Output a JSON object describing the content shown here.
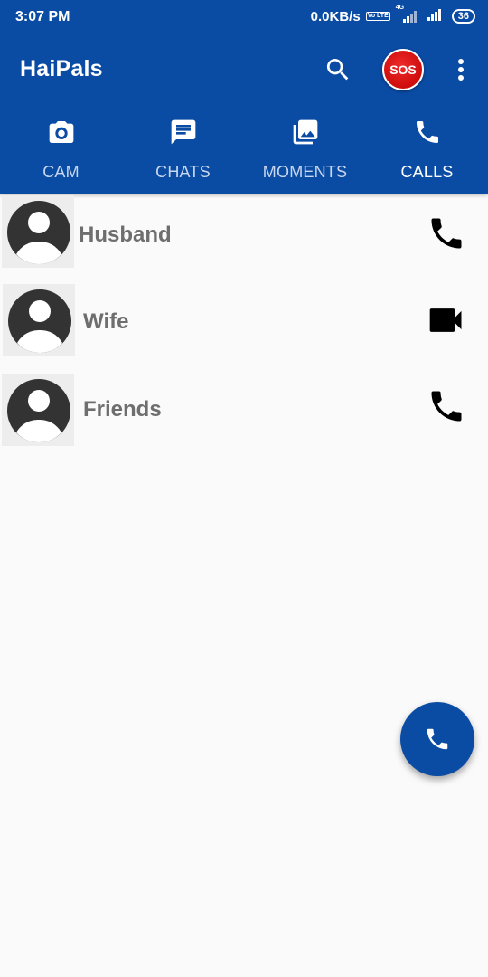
{
  "status_bar": {
    "time": "3:07 PM",
    "net_speed": "0.0KB/s",
    "volte": "Vo LTE",
    "network_label": "4G",
    "battery": "36"
  },
  "app_bar": {
    "title": "HaiPals",
    "sos_label": "SOS"
  },
  "tabs": [
    {
      "label": "CAM",
      "icon": "camera-icon",
      "active": false
    },
    {
      "label": "CHATS",
      "icon": "chat-icon",
      "active": false
    },
    {
      "label": "MOMENTS",
      "icon": "photos-icon",
      "active": false
    },
    {
      "label": "CALLS",
      "icon": "phone-icon",
      "active": true
    }
  ],
  "contacts": [
    {
      "name": "Husband",
      "action_icon": "phone-icon"
    },
    {
      "name": "Wife",
      "action_icon": "video-camera-icon"
    },
    {
      "name": "Friends",
      "action_icon": "phone-icon"
    }
  ],
  "fab": {
    "icon": "phone-icon"
  },
  "colors": {
    "primary": "#0a4ba4",
    "sos": "#d40000",
    "name_text": "#6e6e6e",
    "background": "#fafafa"
  }
}
